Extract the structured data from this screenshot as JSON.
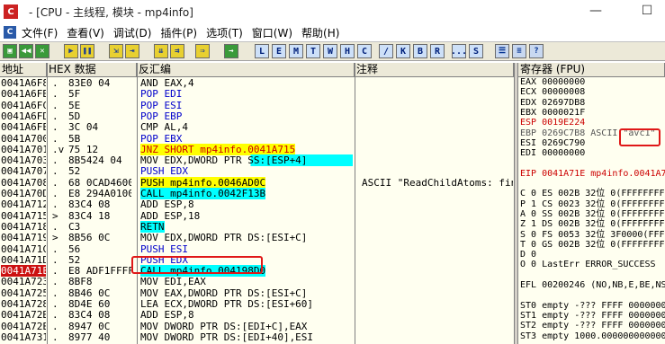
{
  "window": {
    "title": "- [CPU - 主线程, 模块 - mp4info]",
    "app_icon": "C",
    "min": "—",
    "max": "☐"
  },
  "menu": [
    {
      "label": "文件(F)"
    },
    {
      "label": "查看(V)"
    },
    {
      "label": "调试(D)"
    },
    {
      "label": "插件(P)"
    },
    {
      "label": "选项(T)"
    },
    {
      "label": "窗口(W)"
    },
    {
      "label": "帮助(H)"
    }
  ],
  "toolbar": {
    "letters": [
      "L",
      "E",
      "M",
      "T",
      "W",
      "H",
      "C",
      "/",
      "K",
      "B",
      "R",
      "...",
      "S"
    ]
  },
  "headers": {
    "address": "地址",
    "hex": "HEX 数据",
    "disasm": "反汇编",
    "comment": "注释",
    "registers": "寄存器 (FPU)"
  },
  "code_rows": [
    {
      "addr": "0041A6F8",
      "mk": ".",
      "hex": "83E0 04",
      "dis": "AND EAX,4",
      "cmt": ""
    },
    {
      "addr": "0041A6FB",
      "mk": ".",
      "hex": "5F",
      "dis": "POP EDI",
      "cmt": ""
    },
    {
      "addr": "0041A6FC",
      "mk": ".",
      "hex": "5E",
      "dis": "POP ESI",
      "cmt": ""
    },
    {
      "addr": "0041A6FD",
      "mk": ".",
      "hex": "5D",
      "dis": "POP EBP",
      "cmt": ""
    },
    {
      "addr": "0041A6FE",
      "mk": ".",
      "hex": "3C 04",
      "dis": "CMP AL,4",
      "cmt": ""
    },
    {
      "addr": "0041A700",
      "mk": ".",
      "hex": "5B",
      "dis": "POP EBX",
      "cmt": ""
    },
    {
      "addr": "0041A701",
      "mk": ".v",
      "hex": "75 12",
      "dis": "JNZ SHORT mp4info.0041A715",
      "cmt": ""
    },
    {
      "addr": "0041A703",
      "mk": ".",
      "hex": "8B5424 04",
      "dis": "MOV EDX,DWORD PTR SS:[ESP+4]",
      "cmt": ""
    },
    {
      "addr": "0041A707",
      "mk": ".",
      "hex": "52",
      "dis": "PUSH EDX",
      "cmt": ""
    },
    {
      "addr": "0041A708",
      "mk": ".",
      "hex": "68 0CAD4600",
      "dis": "PUSH mp4info.0046AD0C",
      "cmt": "ASCII \"ReadChildAtoms: fin"
    },
    {
      "addr": "0041A70D",
      "mk": ".",
      "hex": "E8 294A0100",
      "dis": "CALL mp4info.0042F13B",
      "cmt": ""
    },
    {
      "addr": "0041A712",
      "mk": ".",
      "hex": "83C4 08",
      "dis": "ADD ESP,8",
      "cmt": ""
    },
    {
      "addr": "0041A715",
      "mk": ">",
      "hex": "83C4 18",
      "dis": "ADD ESP,18",
      "cmt": ""
    },
    {
      "addr": "0041A718",
      "mk": ".",
      "hex": "C3",
      "dis": "RETN",
      "cmt": ""
    },
    {
      "addr": "0041A719",
      "mk": ">",
      "hex": "8B56 0C",
      "dis": "MOV EDX,DWORD PTR DS:[ESI+C]",
      "cmt": ""
    },
    {
      "addr": "0041A71C",
      "mk": ".",
      "hex": "56",
      "dis": "PUSH ESI",
      "cmt": ""
    },
    {
      "addr": "0041A71D",
      "mk": ".",
      "hex": "52",
      "dis": "PUSH EDX",
      "cmt": ""
    },
    {
      "addr": "0041A71E",
      "mk": ".",
      "hex": "E8 ADF1FFFF",
      "dis": "CALL mp4info.004198D0",
      "cmt": ""
    },
    {
      "addr": "0041A723",
      "mk": ".",
      "hex": "8BF8",
      "dis": "MOV EDI,EAX",
      "cmt": ""
    },
    {
      "addr": "0041A725",
      "mk": ".",
      "hex": "8B46 0C",
      "dis": "MOV EAX,DWORD PTR DS:[ESI+C]",
      "cmt": ""
    },
    {
      "addr": "0041A728",
      "mk": ".",
      "hex": "8D4E 60",
      "dis": "LEA ECX,DWORD PTR DS:[ESI+60]",
      "cmt": ""
    },
    {
      "addr": "0041A72B",
      "mk": ".",
      "hex": "83C4 08",
      "dis": "ADD ESP,8",
      "cmt": ""
    },
    {
      "addr": "0041A72E",
      "mk": ".",
      "hex": "8947 0C",
      "dis": "MOV DWORD PTR DS:[EDI+C],EAX",
      "cmt": ""
    },
    {
      "addr": "0041A731",
      "mk": ".",
      "hex": "8977 40",
      "dis": "MOV DWORD PTR DS:[EDI+40],ESI",
      "cmt": ""
    }
  ],
  "registers": [
    "EAX 00000000",
    "ECX 00000008",
    "EDX 02697DB8",
    "EBX 0000021F",
    "ESP 0019E224",
    "EBP 0269C7B8 ASCII \"avc1\"",
    "ESI 0269C790",
    "EDI 00000000",
    "",
    "EIP 0041A71E mp4info.0041A71E",
    "",
    "C 0  ES 002B 32位 0(FFFFFFFF)",
    "P 1  CS 0023 32位 0(FFFFFFFF)",
    "A 0  SS 002B 32位 0(FFFFFFFF)",
    "Z 1  DS 002B 32位 0(FFFFFFFF)",
    "S 0  FS 0053 32位 3F0000(FFF)",
    "T 0  GS 002B 32位 0(FFFFFFFF)",
    "D 0",
    "O 0  LastErr ERROR_SUCCESS",
    "",
    "EFL 00200246 (NO,NB,E,BE,NS",
    "",
    "ST0 empty -??? FFFF 00000000",
    "ST1 empty -??? FFFF 00000000",
    "ST2 empty -??? FFFF 00000000",
    "ST3 empty 1000.000000000000"
  ],
  "colors": {
    "code_bg": "#fffff0",
    "selected_addr_bg": "#cc1111",
    "call_bg": "#00ffff",
    "jmp_bg": "#ffff00",
    "keyword": "#0000cc",
    "highlight_box": "#e01818"
  }
}
